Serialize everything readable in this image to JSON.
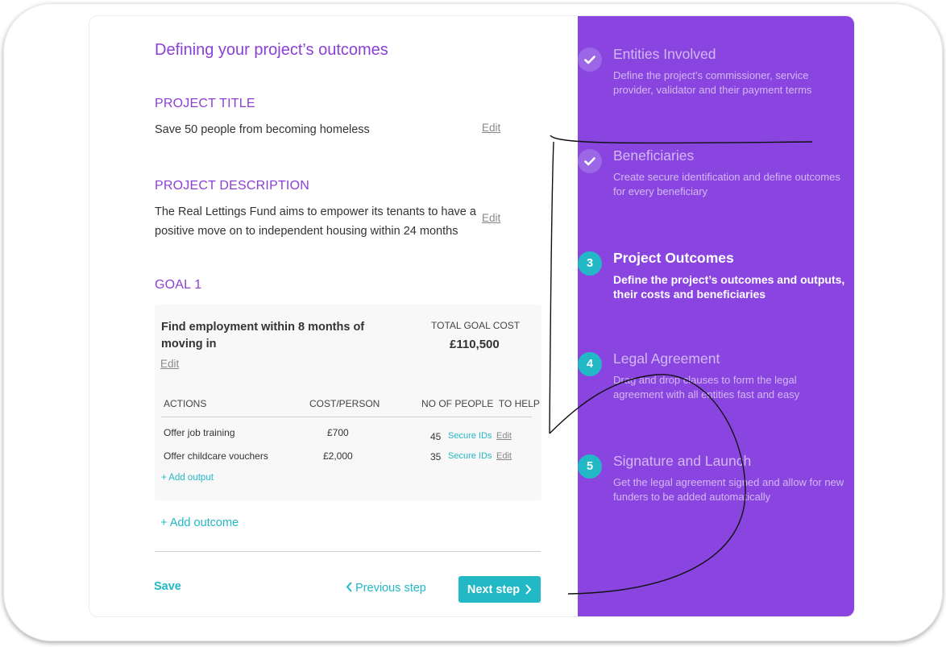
{
  "page": {
    "heading": "Defining your project’s outcomes"
  },
  "project_title": {
    "label": "PROJECT TITLE",
    "value": "Save 50 people from becoming homeless",
    "edit": "Edit"
  },
  "project_description": {
    "label": "PROJECT DESCRIPTION",
    "value": "The Real Lettings Fund aims to empower its tenants to have a positive move on to independent housing within 24 months",
    "edit": "Edit"
  },
  "goal": {
    "label": "GOAL 1",
    "name": "Find employment within 8 months of moving in",
    "edit": "Edit",
    "cost_caption": "TOTAL GOAL COST",
    "cost_value": "£110,500",
    "columns": {
      "actions": "ACTIONS",
      "cost": "COST/PERSON",
      "people": "NO OF PEOPLE  TO HELP"
    },
    "rows": [
      {
        "action": "Offer job training",
        "cost": "£700",
        "people": "45",
        "secure": "Secure IDs",
        "edit": "Edit"
      },
      {
        "action": "Offer childcare vouchers",
        "cost": "£2,000",
        "people": "35",
        "secure": "Secure IDs",
        "edit": "Edit"
      }
    ],
    "add_output": "+ Add output"
  },
  "add_outcome": "+ Add outcome",
  "footer": {
    "save": "Save",
    "previous": "Previous step",
    "next": "Next step"
  },
  "steps": [
    {
      "marker": "check-icon",
      "status": "done",
      "title": "Entities Involved",
      "desc": "Define the project’s commissioner, service provider, validator and their payment terms"
    },
    {
      "marker": "check-icon",
      "status": "done",
      "title": "Beneficiaries",
      "desc": "Create secure identification and define outcomes for every beneficiary"
    },
    {
      "marker": "3",
      "status": "active",
      "title": "Project Outcomes",
      "desc": "Define the project’s outcomes and outputs, their costs and beneficiaries"
    },
    {
      "marker": "4",
      "status": "todo",
      "title": "Legal Agreement",
      "desc": "Drag and drop clauses to form the legal agreement with all entities fast and  easy"
    },
    {
      "marker": "5",
      "status": "todo",
      "title": "Signature and Launch",
      "desc": "Get the legal agreement signed and allow for new funders to be added automatically"
    }
  ],
  "colors": {
    "purple_panel": "#8a44e0",
    "purple_text": "#8b3fd6",
    "teal": "#22b8c6"
  }
}
